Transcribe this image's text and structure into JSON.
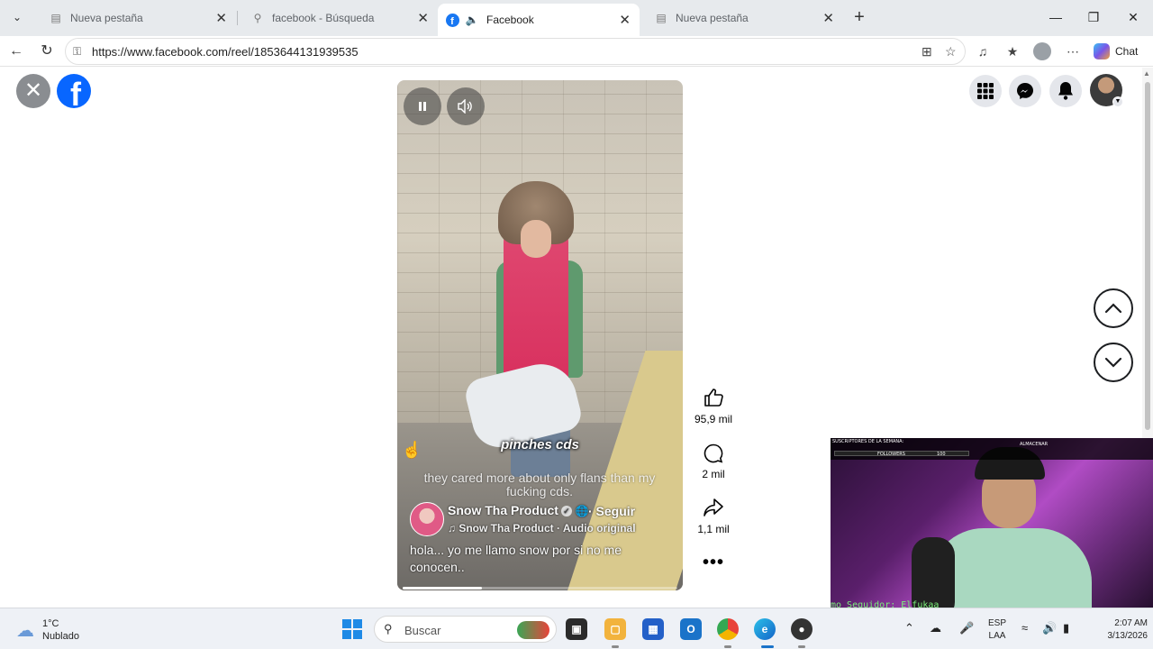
{
  "browser": {
    "tabs": [
      {
        "title": "Nueva pestaña",
        "icon": "page-icon",
        "active": false
      },
      {
        "title": "facebook - Búsqueda",
        "icon": "search-icon",
        "active": false
      },
      {
        "title": "Facebook",
        "icon": "facebook-icon",
        "active": true
      },
      {
        "title": "Nueva pestaña",
        "icon": "page-icon",
        "active": false
      }
    ],
    "url": "https://www.facebook.com/reel/1853644131939535",
    "chat_label": "Chat"
  },
  "reel": {
    "caption_highlight": "pinches cds",
    "caption_subtitle": "they cared more about only flans than my fucking cds.",
    "author": "Snow Tha Product",
    "follow_label": "· Seguir",
    "audio": "♫ Snow Tha Product · Audio original",
    "description": "hola... yo me llamo snow por si no me conocen..",
    "progress": 0.29,
    "likes": "95,9 mil",
    "comments": "2 mil",
    "shares": "1,1 mil"
  },
  "webcam": {
    "hud_left": "SUSCRIPTORES DE LA SEMANA:",
    "hud_followers": "FOLLOWERS",
    "hud_count": "100",
    "hud_right": "ALMACENAR",
    "ticker": "mo Seguidor: Elfukaa"
  },
  "taskbar": {
    "temperature": "1°C",
    "weather": "Nublado",
    "search_placeholder": "Buscar",
    "lang_top": "ESP",
    "lang_bottom": "LAA",
    "time": "2:07 AM",
    "date": "3/13/2026"
  },
  "colors": {
    "facebook_blue": "#0866ff",
    "tab_strip": "#e7eaed",
    "taskbar": "#eef1f6"
  }
}
